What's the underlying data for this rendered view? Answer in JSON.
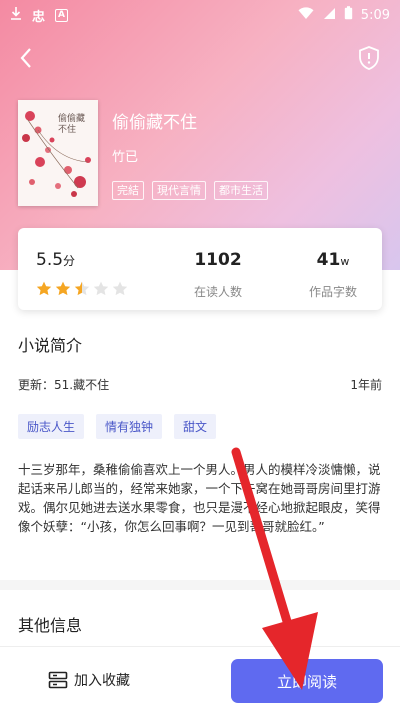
{
  "status_bar": {
    "time": "5:09",
    "battery_glyph": "B"
  },
  "book": {
    "cover_title": "偷偷藏不住",
    "title": "偷偷藏不住",
    "author": "竹已",
    "tags": [
      "完結",
      "現代言情",
      "都市生活"
    ]
  },
  "stats": {
    "score_value": "5.5",
    "score_unit": "分",
    "rating_stars": 2.5,
    "readers_count": "1102",
    "readers_label": "在读人数",
    "words_count": "41",
    "words_unit": "w",
    "words_label": "作品字数"
  },
  "intro": {
    "heading": "小说简介",
    "update_label": "更新：51.藏不住",
    "update_time": "1年前",
    "chips": [
      "励志人生",
      "情有独钟",
      "甜文"
    ],
    "summary": "十三岁那年，桑稚偷偷喜欢上一个男人。男人的模样冷淡慵懒，说起话来吊儿郎当的，经常来她家，一个下午窝在她哥哥房间里打游戏。偶尔见她进去送水果零食，也只是漫不经心地掀起眼皮，笑得像个妖孽：“小孩，你怎么回事啊？一见到哥哥就脸红。”"
  },
  "other": {
    "heading": "其他信息"
  },
  "bottom_bar": {
    "favorite_label": "加入收藏",
    "read_label": "立即阅读"
  },
  "colors": {
    "accent": "#5f6af0",
    "hero_gradient_start": "#f48aa2",
    "hero_gradient_end": "#d8c6ee",
    "star_filled": "#f5a623",
    "arrow": "#e5262b"
  },
  "icons": {
    "back": "chevron-left-icon",
    "report": "shield-alert-icon",
    "favorite": "bookshelf-icon",
    "star": "star-icon"
  }
}
